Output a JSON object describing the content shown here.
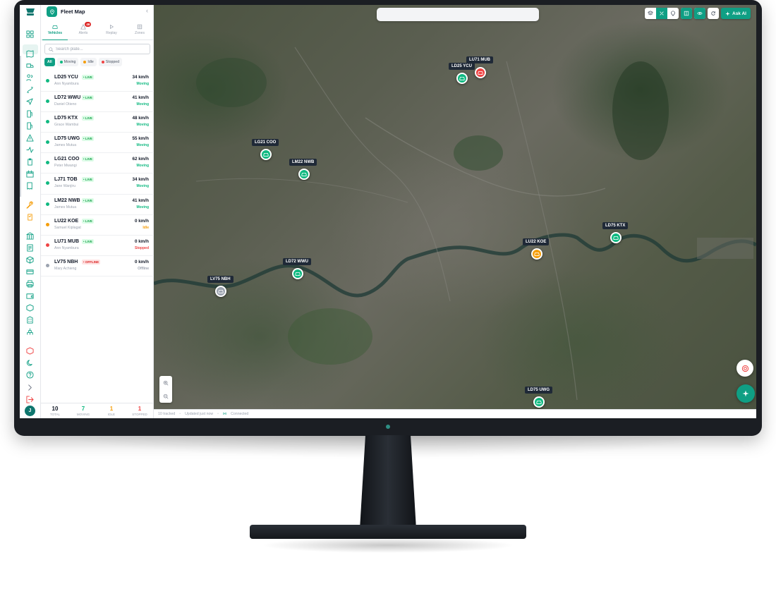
{
  "app": {
    "title": "Fleet Map"
  },
  "tabs": [
    {
      "label": "Vehicles",
      "icon": "car-icon"
    },
    {
      "label": "Alerts",
      "icon": "warning-icon",
      "badge": "46"
    },
    {
      "label": "Replay",
      "icon": "play-icon"
    },
    {
      "label": "Zones",
      "icon": "grid-icon"
    }
  ],
  "search": {
    "placeholder": "Search plate..."
  },
  "filters": [
    {
      "label": "All",
      "color": ""
    },
    {
      "label": "Moving",
      "color": "#10b981"
    },
    {
      "label": "Idle",
      "color": "#f59e0b"
    },
    {
      "label": "Stopped",
      "color": "#ef4444"
    }
  ],
  "vehicles": [
    {
      "plate": "LD25 YCU",
      "driver": "Ann Nyambura",
      "speed": "34 km/h",
      "state": "Moving",
      "tag": "LIVE",
      "color": "#10b981"
    },
    {
      "plate": "LD72 WWU",
      "driver": "Daniel Otieno",
      "speed": "41 km/h",
      "state": "Moving",
      "tag": "LIVE",
      "color": "#10b981"
    },
    {
      "plate": "LD75 KTX",
      "driver": "Grace Wambui",
      "speed": "48 km/h",
      "state": "Moving",
      "tag": "LIVE",
      "color": "#10b981"
    },
    {
      "plate": "LD75 UWG",
      "driver": "James Mutua",
      "speed": "55 km/h",
      "state": "Moving",
      "tag": "LIVE",
      "color": "#10b981"
    },
    {
      "plate": "LG21 COO",
      "driver": "Peter Mwangi",
      "speed": "62 km/h",
      "state": "Moving",
      "tag": "LIVE",
      "color": "#10b981"
    },
    {
      "plate": "LJ71 TOB",
      "driver": "Jane Wanjiru",
      "speed": "34 km/h",
      "state": "Moving",
      "tag": "LIVE",
      "color": "#10b981"
    },
    {
      "plate": "LM22 NWB",
      "driver": "James Mutua",
      "speed": "41 km/h",
      "state": "Moving",
      "tag": "LIVE",
      "color": "#10b981"
    },
    {
      "plate": "LU22 KOE",
      "driver": "Samuel Kiplagat",
      "speed": "0 km/h",
      "state": "Idle",
      "tag": "LIVE",
      "color": "#f59e0b"
    },
    {
      "plate": "LU71 MUB",
      "driver": "Ann Nyambura",
      "speed": "0 km/h",
      "state": "Stopped",
      "tag": "LIVE",
      "color": "#ef4444"
    },
    {
      "plate": "LV75 NBH",
      "driver": "Mary Achieng",
      "speed": "0 km/h",
      "state": "Offline",
      "tag": "OFFLINE",
      "color": "#9ca3af"
    }
  ],
  "stats": [
    {
      "value": "10",
      "label": "TOTAL",
      "color": "#111827"
    },
    {
      "value": "7",
      "label": "MOVING",
      "color": "#10b981"
    },
    {
      "value": "1",
      "label": "IDLE",
      "color": "#f59e0b"
    },
    {
      "value": "1",
      "label": "STOPPED",
      "color": "#ef4444"
    }
  ],
  "map": {
    "ask_ai": "Ask AI",
    "markers": [
      {
        "plate": "LD25 YCU",
        "state": "Moving"
      },
      {
        "plate": "LU71 MUB",
        "state": "Stopped"
      },
      {
        "plate": "LG21 COO",
        "state": "Moving"
      },
      {
        "plate": "LM22 NWB",
        "state": "Moving"
      },
      {
        "plate": "LD75 KTX",
        "state": "Moving"
      },
      {
        "plate": "LU22 KOE",
        "state": "Idle"
      },
      {
        "plate": "LD72 WWU",
        "state": "Moving"
      },
      {
        "plate": "LV75 NBH",
        "state": "Offline"
      },
      {
        "plate": "LD75 UWG",
        "state": "Moving"
      }
    ]
  },
  "status": {
    "tracked": "10 tracked",
    "updated": "Updated just now",
    "connection": "Connected"
  },
  "user": {
    "initial": "J"
  },
  "colors": {
    "accent": "#0f9f84",
    "moving": "#10b981",
    "idle": "#f59e0b",
    "stopped": "#ef4444",
    "offline": "#9ca3af"
  }
}
